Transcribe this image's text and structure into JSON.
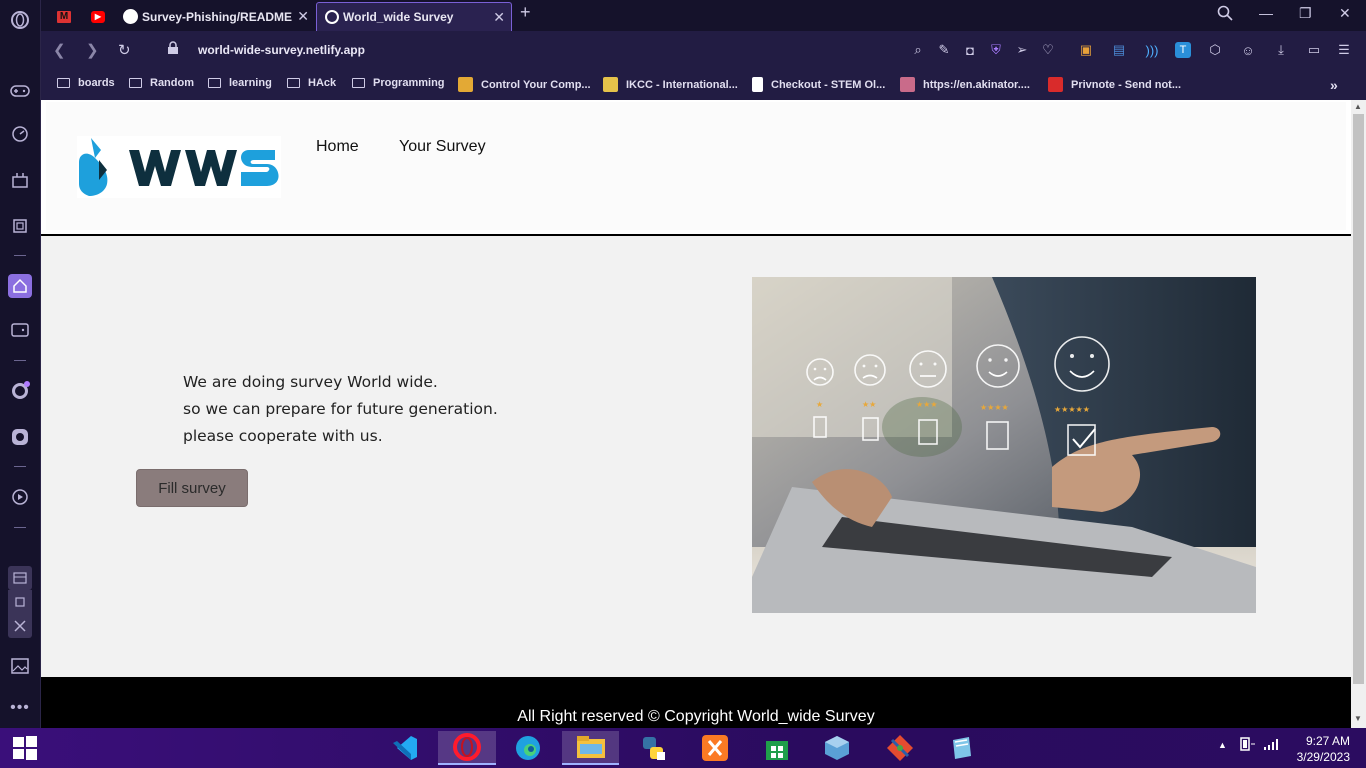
{
  "browser": {
    "tabs": [
      {
        "label": ""
      },
      {
        "label": ""
      },
      {
        "label": "Survey-Phishing/README.m"
      },
      {
        "label": "World_wide Survey"
      }
    ],
    "url": "world-wide-survey.netlify.app",
    "bookmarks": [
      {
        "label": "boards"
      },
      {
        "label": "Random"
      },
      {
        "label": "learning"
      },
      {
        "label": "HAck"
      },
      {
        "label": "Programming"
      },
      {
        "label": "Control Your Comp..."
      },
      {
        "label": "IKCC - International..."
      },
      {
        "label": "Checkout - STEM Ol..."
      },
      {
        "label": "https://en.akinator...."
      },
      {
        "label": "Privnote - Send not..."
      }
    ],
    "more_bookmarks": "»"
  },
  "site": {
    "nav": {
      "home": "Home",
      "your_survey": "Your Survey"
    },
    "hero": {
      "line1": "We are doing survey World wide.",
      "line2": "so we can prepare for future generation.",
      "line3": "please cooperate with us.",
      "button": "Fill survey"
    },
    "footer": "All Right reserved © Copyright World_wide Survey"
  },
  "taskbar": {
    "time": "9:27 AM",
    "date": "3/29/2023"
  },
  "colors": {
    "accent": "#7a60d6",
    "logo_blue": "#1ea0dc",
    "logo_dark": "#0e2f3e",
    "button_bg": "#8a7c7c"
  }
}
